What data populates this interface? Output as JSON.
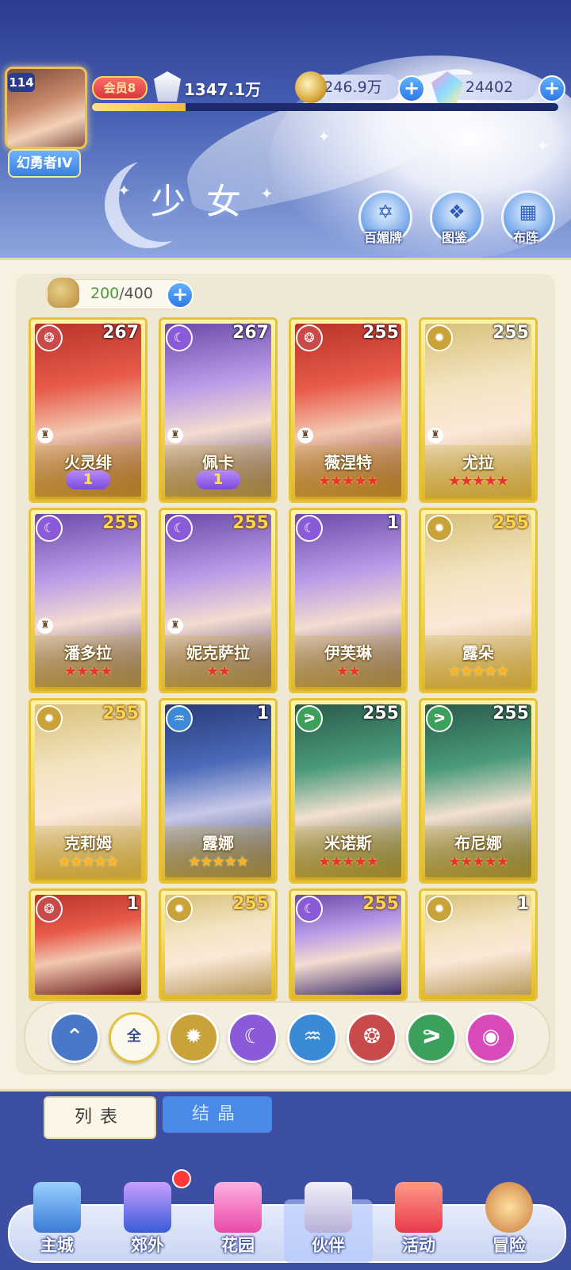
{
  "player": {
    "level": "114",
    "title": "幻勇者IV",
    "vip": "会员8",
    "power": "1347.1万",
    "exp_fraction": 0.2
  },
  "currencies": [
    {
      "value": "246.9万",
      "icon": "gold-coin-icon"
    },
    {
      "value": "24402",
      "icon": "diamond-icon"
    }
  ],
  "page_title": "少女",
  "top_buttons": [
    {
      "label": "百媚牌",
      "icon": "card-deck-icon"
    },
    {
      "label": "图鉴",
      "icon": "book-icon"
    },
    {
      "label": "布阵",
      "icon": "grid-formation-icon"
    }
  ],
  "capacity": {
    "current": "200",
    "sep": "/400"
  },
  "characters": [
    {
      "name": "火灵绯",
      "level": "267",
      "element": "fire",
      "stars": 0,
      "rank": "1",
      "star_color": "red"
    },
    {
      "name": "佩卡",
      "level": "267",
      "element": "moon",
      "stars": 0,
      "rank": "1",
      "star_color": "red"
    },
    {
      "name": "薇涅特",
      "level": "255",
      "element": "fire",
      "stars": 5,
      "rank": "",
      "star_color": "red"
    },
    {
      "name": "尤拉",
      "level": "255",
      "element": "sun",
      "stars": 5,
      "rank": "",
      "star_color": "red"
    },
    {
      "name": "潘多拉",
      "level": "255",
      "element": "moon",
      "stars": 4,
      "rank": "",
      "star_color": "red"
    },
    {
      "name": "妮克萨拉",
      "level": "255",
      "element": "moon",
      "stars": 2,
      "rank": "",
      "star_color": "red"
    },
    {
      "name": "伊芙琳",
      "level": "1",
      "element": "moon",
      "stars": 2,
      "rank": "",
      "star_color": "red"
    },
    {
      "name": "露朵",
      "level": "255",
      "element": "sun",
      "stars": 5,
      "rank": "",
      "star_color": "gold"
    },
    {
      "name": "克莉姆",
      "level": "255",
      "element": "sun",
      "stars": 5,
      "rank": "",
      "star_color": "gold"
    },
    {
      "name": "露娜",
      "level": "1",
      "element": "water",
      "stars": 5,
      "rank": "",
      "star_color": "gold"
    },
    {
      "name": "米诺斯",
      "level": "255",
      "element": "wind",
      "stars": 5,
      "rank": "",
      "star_color": "red"
    },
    {
      "name": "布尼娜",
      "level": "255",
      "element": "wind",
      "stars": 5,
      "rank": "",
      "star_color": "red"
    },
    {
      "name": "",
      "level": "1",
      "element": "fire",
      "stars": 0,
      "rank": "",
      "star_color": "red"
    },
    {
      "name": "",
      "level": "255",
      "element": "sun",
      "stars": 0,
      "rank": "",
      "star_color": "red"
    },
    {
      "name": "",
      "level": "255",
      "element": "moon",
      "stars": 0,
      "rank": "",
      "star_color": "red"
    },
    {
      "name": "",
      "level": "1",
      "element": "sun",
      "stars": 0,
      "rank": "",
      "star_color": "red"
    }
  ],
  "filters": [
    {
      "key": "up",
      "label": ""
    },
    {
      "key": "all",
      "label": "全"
    },
    {
      "key": "sun",
      "label": ""
    },
    {
      "key": "moon",
      "label": ""
    },
    {
      "key": "water",
      "label": ""
    },
    {
      "key": "fire",
      "label": ""
    },
    {
      "key": "wind",
      "label": ""
    },
    {
      "key": "dark",
      "label": ""
    }
  ],
  "tabs": {
    "list": "列表",
    "crystal": "结晶"
  },
  "nav": [
    {
      "label": "主城",
      "icon": "castle-icon"
    },
    {
      "label": "郊外",
      "icon": "compass-icon"
    },
    {
      "label": "花园",
      "icon": "heart-icon"
    },
    {
      "label": "伙伴",
      "icon": "partner-avatar-icon"
    },
    {
      "label": "活动",
      "icon": "gift-icon"
    },
    {
      "label": "冒险",
      "icon": "adventure-icon"
    }
  ],
  "colors": {
    "fire": "#c94a4a",
    "moon": "#8a5ad8",
    "sun": "#c9a23a",
    "water": "#3a8ad8",
    "wind": "#3aa05a",
    "dark": "#d84ab8",
    "up": "#4a78c8"
  }
}
